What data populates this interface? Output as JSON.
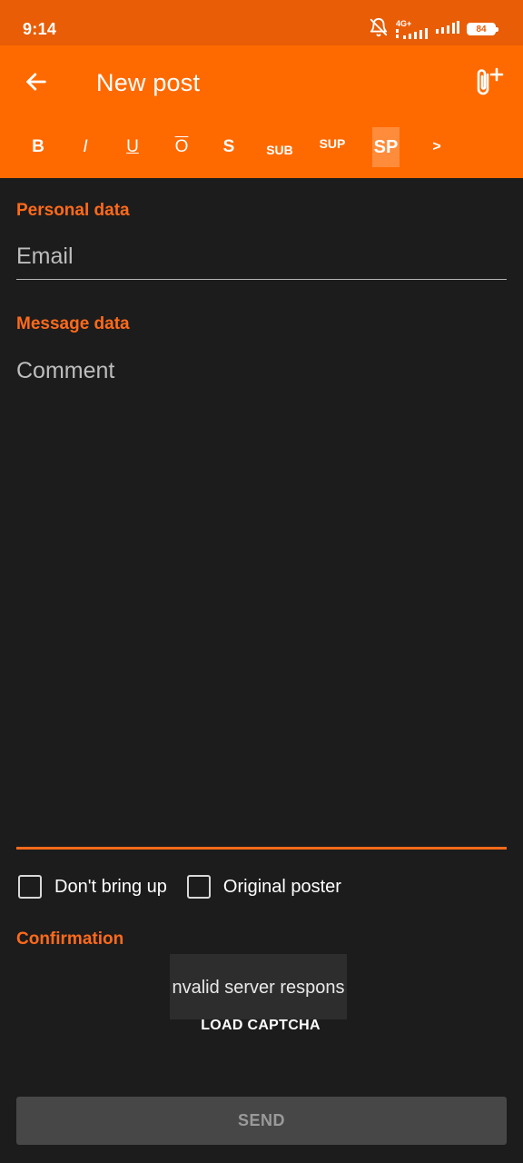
{
  "status_bar": {
    "time": "9:14",
    "network_label": "4G+",
    "battery_level": "84",
    "icons": [
      "bell-off-icon",
      "signal-4g-icon",
      "signal-icon",
      "battery-icon"
    ]
  },
  "app_bar": {
    "title": "New post",
    "back_icon": "arrow-left-icon",
    "attach_icon": "paperclip-plus-icon",
    "accent": "#ff6a00"
  },
  "format_toolbar": {
    "bold": "B",
    "italic": "I",
    "underline": "U",
    "overline": "O",
    "strike": "S",
    "sub": "SUB",
    "sup": "SUP",
    "spoiler": "SP",
    "quote": ">"
  },
  "personal_section": {
    "label": "Personal data",
    "email_placeholder": "Email",
    "email_value": ""
  },
  "message_section": {
    "label": "Message data",
    "comment_placeholder": "Comment",
    "comment_value": ""
  },
  "options": {
    "dont_bring_up": {
      "label": "Don't bring up",
      "checked": false
    },
    "original_poster": {
      "label": "Original poster",
      "checked": false
    }
  },
  "confirmation": {
    "label": "Confirmation",
    "captcha_message": "nvalid server respons",
    "load_captcha": "LOAD CAPTCHA"
  },
  "send_button": {
    "label": "SEND",
    "enabled": false
  },
  "colors": {
    "status_bar": "#e85d06",
    "app_bar": "#ff6a00",
    "background": "#1c1c1c",
    "section_label": "#ff6a1a",
    "send_disabled": "#474747"
  }
}
